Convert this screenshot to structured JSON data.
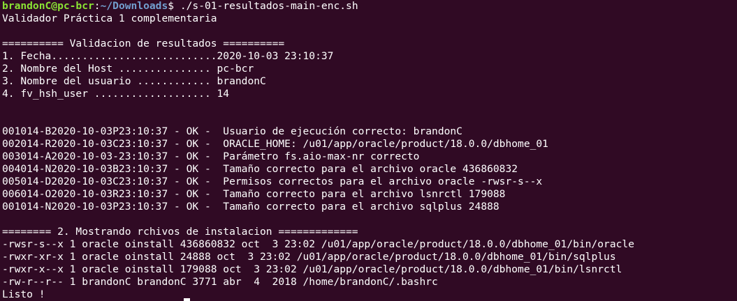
{
  "prompt": {
    "user_host": "brandonC@pc-bcr",
    "separator": ":",
    "path": "~/Downloads",
    "symbol": "$",
    "command": " ./s-01-resultados-main-enc.sh"
  },
  "header_line": "Validador Práctica 1 complementaria",
  "section1": {
    "title": "========== Validacion de resultados ==========",
    "items": [
      "1. Fecha...........................2020-10-03 23:10:37",
      "2. Nombre del Host ............... pc-bcr",
      "3. Nombre del usuario ............ brandonC",
      "4. fv_hsh_user ................... 14"
    ]
  },
  "results": [
    "001014-B2020-10-03P23:10:37 - OK -  Usuario de ejecución correcto: brandonC",
    "002014-R2020-10-03C23:10:37 - OK -  ORACLE_HOME: /u01/app/oracle/product/18.0.0/dbhome_01",
    "003014-A2020-10-03-23:10:37 - OK -  Parámetro fs.aio-max-nr correcto",
    "004014-N2020-10-03B23:10:37 - OK -  Tamaño correcto para el archivo oracle 436860832",
    "005014-D2020-10-03C23:10:37 - OK -  Permisos correctos para el archivo oracle -rwsr-s--x",
    "006014-O2020-10-03R23:10:37 - OK -  Tamaño correcto para el archivo lsnrctl 179088",
    "001014-N2020-10-03P23:10:37 - OK -  Tamaño correcto para el archivo sqlplus 24888"
  ],
  "section2": {
    "title": "======== 2. Mostrando rchivos de instalacion =============",
    "files": [
      "-rwsr-s--x 1 oracle oinstall 436860832 oct  3 23:02 /u01/app/oracle/product/18.0.0/dbhome_01/bin/oracle",
      "-rwxr-xr-x 1 oracle oinstall 24888 oct  3 23:02 /u01/app/oracle/product/18.0.0/dbhome_01/bin/sqlplus",
      "-rwxr-x--x 1 oracle oinstall 179088 oct  3 23:02 /u01/app/oracle/product/18.0.0/dbhome_01/bin/lsnrctl",
      "-rw-r--r-- 1 brandonC brandonC 3771 abr  4  2018 /home/brandonC/.bashrc"
    ]
  },
  "footer": "Listo !",
  "colors": {
    "background": "#300a24",
    "prompt_user": "#8ae234",
    "prompt_path": "#729fcf",
    "text": "#ffffff"
  }
}
